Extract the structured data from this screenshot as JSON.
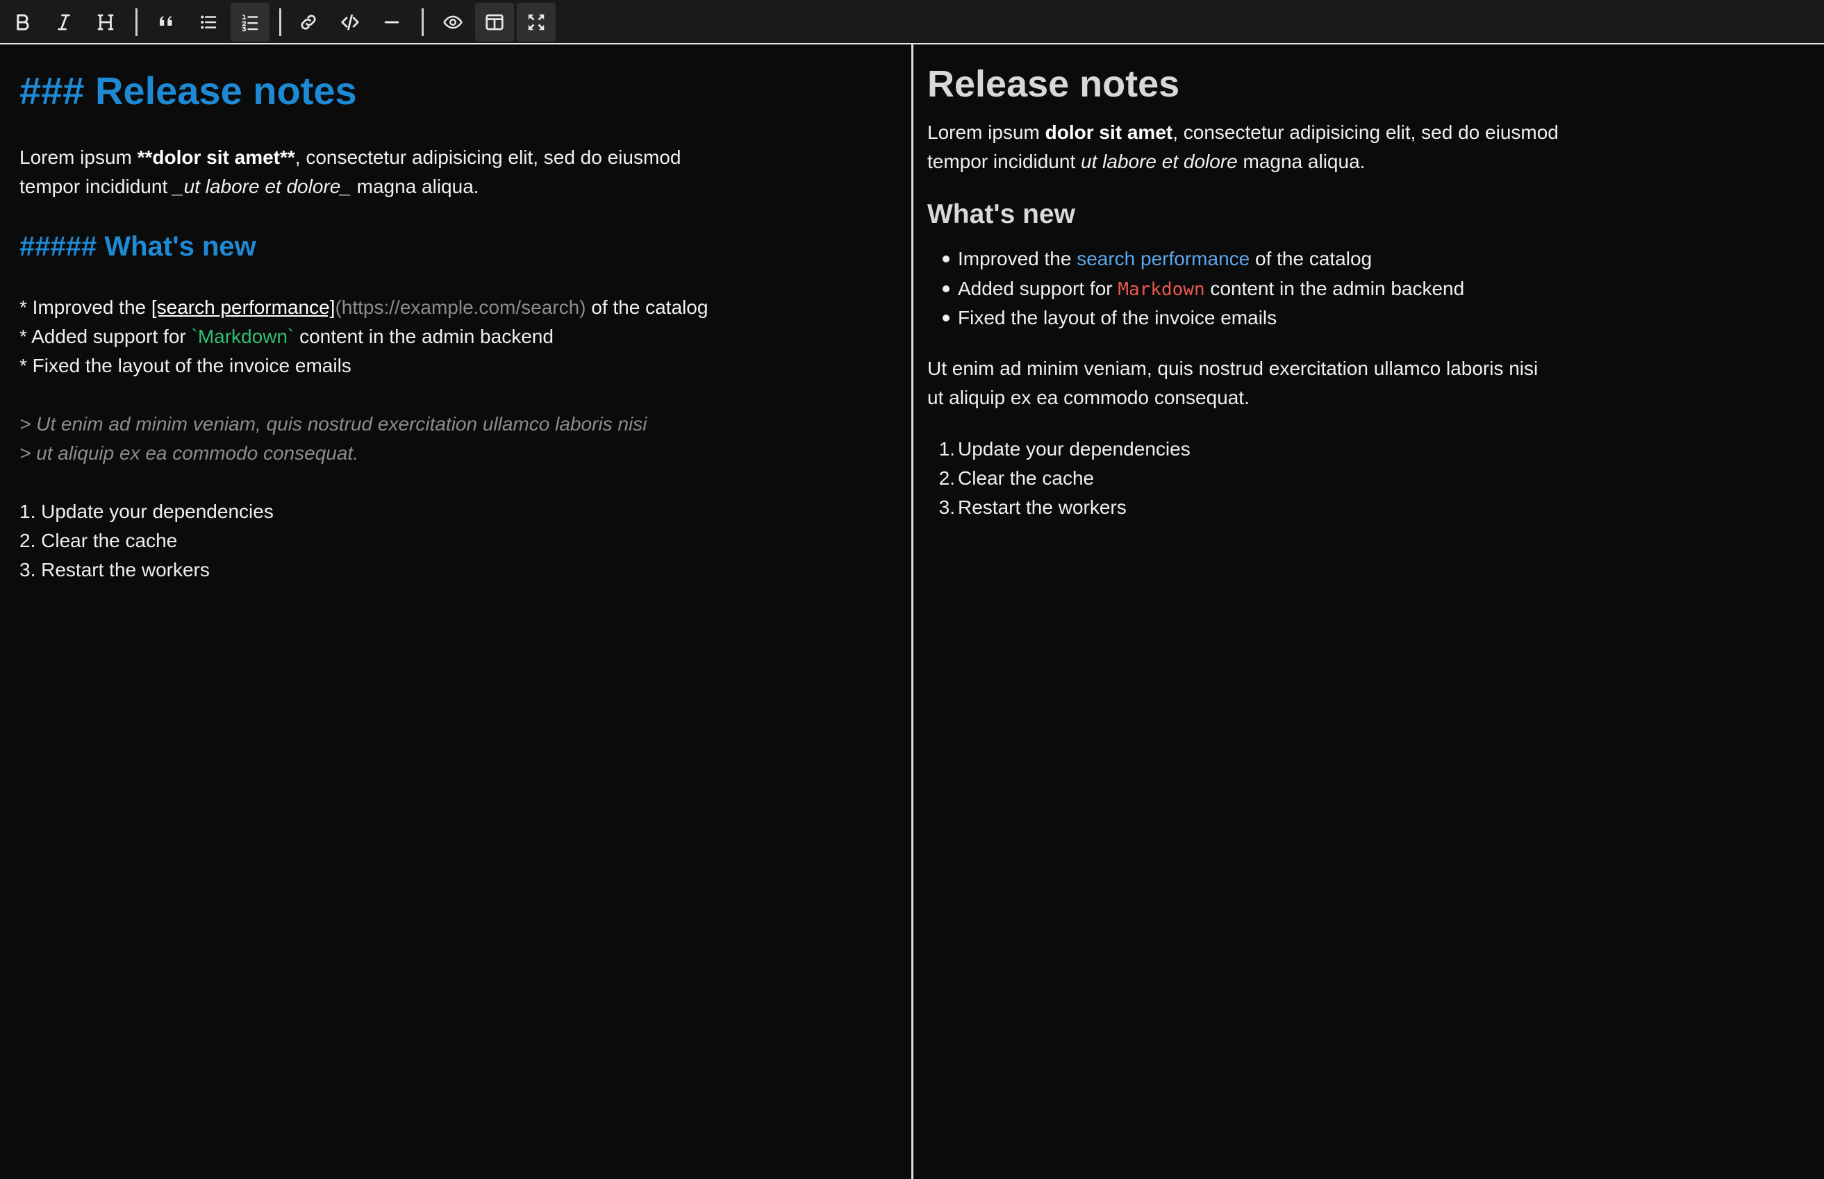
{
  "toolbar": {
    "buttons": [
      {
        "name": "bold",
        "icon": "bold-icon"
      },
      {
        "name": "italic",
        "icon": "italic-icon"
      },
      {
        "name": "heading",
        "icon": "heading-icon"
      },
      {
        "name": "quote",
        "icon": "quote-icon"
      },
      {
        "name": "unordered-list",
        "icon": "unordered-list-icon"
      },
      {
        "name": "ordered-list",
        "icon": "ordered-list-icon",
        "active": true
      },
      {
        "name": "link",
        "icon": "link-icon"
      },
      {
        "name": "code",
        "icon": "code-icon"
      },
      {
        "name": "horizontal-rule",
        "icon": "horizontal-rule-icon"
      },
      {
        "name": "preview",
        "icon": "eye-icon"
      },
      {
        "name": "side-by-side",
        "icon": "columns-icon",
        "active": true
      },
      {
        "name": "fullscreen",
        "icon": "fullscreen-icon",
        "active": true
      }
    ]
  },
  "editor": {
    "heading1": "### Release notes",
    "para_line1_prefix": "Lorem ipsum ",
    "para_line1_bold": "**dolor sit amet**",
    "para_line1_suffix": ", consectetur adipisicing elit, sed do eiusmod",
    "para_line2_prefix": "tempor incididunt ",
    "para_line2_italic": "_ut labore et dolore_",
    "para_line2_suffix": " magna aliqua.",
    "heading2": "##### What's new",
    "bullet1_prefix": "* Improved the ",
    "bullet1_link_text": "[search performance]",
    "bullet1_link_url": "(https://example.com/search)",
    "bullet1_suffix": " of the catalog",
    "bullet2_prefix": "* Added support for ",
    "bullet2_code": "`Markdown`",
    "bullet2_suffix": " content in the admin backend",
    "bullet3": "* Fixed the layout of the invoice emails",
    "quote_line1": "> Ut enim ad minim veniam, quis nostrud exercitation ullamco laboris nisi",
    "quote_line2": "> ut aliquip ex ea commodo consequat.",
    "ol1": "1. Update your dependencies",
    "ol2": "2. Clear the cache",
    "ol3": "3. Restart the workers"
  },
  "preview": {
    "heading1": "Release notes",
    "para_line1_prefix": "Lorem ipsum ",
    "para_line1_bold": "dolor sit amet",
    "para_line1_suffix": ", consectetur adipisicing elit, sed do eiusmod",
    "para_line2_prefix": "tempor incididunt ",
    "para_line2_italic": "ut labore et dolore",
    "para_line2_suffix": " magna aliqua.",
    "heading2": "What's new",
    "bullets": [
      {
        "prefix": "Improved the ",
        "link": "search performance",
        "suffix": " of the catalog"
      },
      {
        "prefix": "Added support for ",
        "code": "Markdown",
        "suffix": " content in the admin backend"
      },
      {
        "text": "Fixed the layout of the invoice emails"
      }
    ],
    "quote_line1": "Ut enim ad minim veniam, quis nostrud exercitation ullamco laboris nisi",
    "quote_line2": "ut aliquip ex ea commodo consequat.",
    "ordered": [
      {
        "num": "1.",
        "text": "Update your dependencies"
      },
      {
        "num": "2.",
        "text": "Clear the cache"
      },
      {
        "num": "3.",
        "text": "Restart the workers"
      }
    ]
  },
  "colors": {
    "heading_blue": "#1e8ad6",
    "code_green": "#2fbf71",
    "link_blue": "#5aa7f0",
    "code_red": "#e8584f",
    "muted": "#8c8c8c"
  }
}
